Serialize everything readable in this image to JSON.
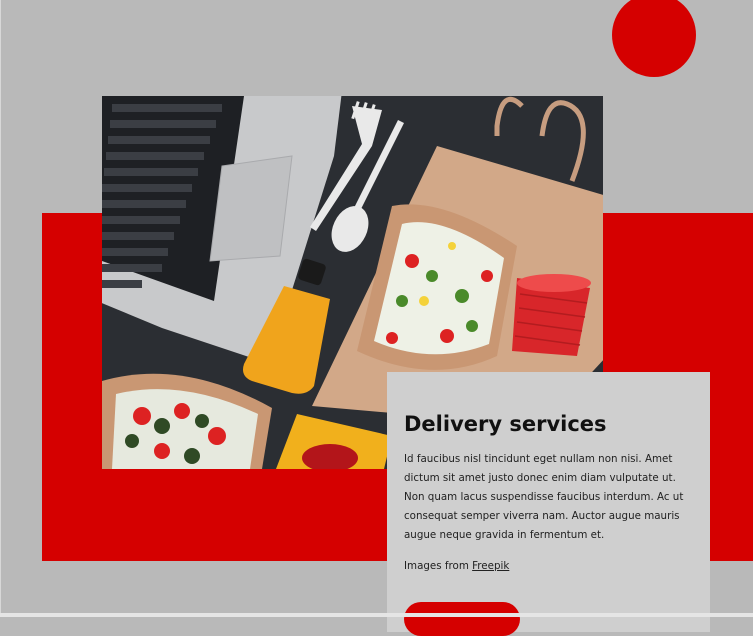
{
  "colors": {
    "background": "#b9b9b9",
    "accent_red": "#d50000",
    "card_background": "#cfcfcf",
    "photo_background": "#2b2e33"
  },
  "hero_image": {
    "depicts": [
      "laptop",
      "fork",
      "spoon",
      "juice-bottle",
      "paper-bag",
      "salad-box",
      "red-paper-cup",
      "salad-bowl",
      "yellow-napkin"
    ]
  },
  "card": {
    "title": "Delivery services",
    "body": "Id faucibus nisl tincidunt eget nullam non nisi. Amet dictum sit amet justo donec enim diam vulputate ut. Non quam lacus suspendisse faucibus interdum. Ac ut consequat semper viverra nam. Auctor augue mauris augue neque gravida in fermentum et.",
    "credit_prefix": "Images from ",
    "credit_link": "Freepik",
    "button_label": ""
  }
}
